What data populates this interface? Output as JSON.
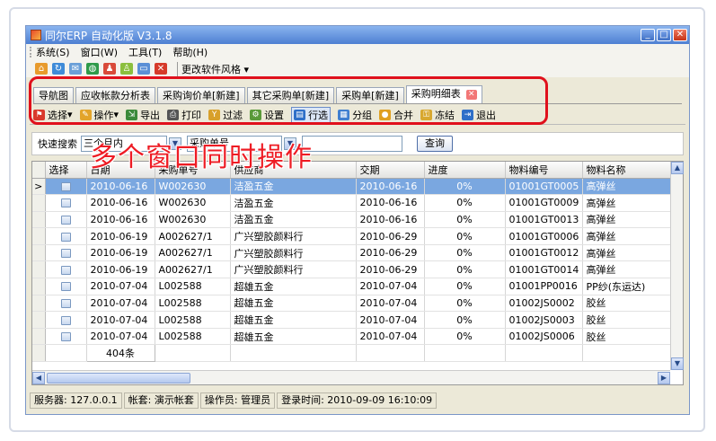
{
  "window": {
    "title": "同尔ERP 自动化版 V3.1.8",
    "controls": [
      "_",
      "□",
      "✕"
    ]
  },
  "menubar": {
    "items": [
      "系统(S)",
      "窗口(W)",
      "工具(T)",
      "帮助(H)"
    ]
  },
  "iconbar": {
    "style_menu_label": "更改软件风格"
  },
  "tabs": [
    {
      "label": "导航图",
      "active": false
    },
    {
      "label": "应收帐款分析表",
      "active": false
    },
    {
      "label": "采购询价单[新建]",
      "active": false
    },
    {
      "label": "其它采购单[新建]",
      "active": false
    },
    {
      "label": "采购单[新建]",
      "active": false
    },
    {
      "label": "采购明细表",
      "active": true
    }
  ],
  "toolbar": {
    "select": "选择",
    "operate": "操作",
    "export": "导出",
    "print": "打印",
    "filter": "过滤",
    "settings": "设置",
    "row_select": "行选",
    "group": "分组",
    "merge": "合并",
    "freeze": "冻结",
    "exit": "退出"
  },
  "search": {
    "label": "快速搜索",
    "range_value": "三个月内",
    "field_value": "采购单号",
    "query_button": "查询"
  },
  "overlay_caption": "多个窗口同时操作",
  "grid": {
    "columns": [
      "选择",
      "日期",
      "采购单号",
      "供应商",
      "交期",
      "进度",
      "物料编号",
      "物料名称"
    ],
    "rows": [
      {
        "date": "2010-06-16",
        "order_no": "W002630",
        "supplier": "洁盈五金",
        "delivery": "2010-06-16",
        "progress": "0%",
        "material_code": "01001GT0005",
        "material_name": "高弹丝"
      },
      {
        "date": "2010-06-16",
        "order_no": "W002630",
        "supplier": "洁盈五金",
        "delivery": "2010-06-16",
        "progress": "0%",
        "material_code": "01001GT0009",
        "material_name": "高弹丝"
      },
      {
        "date": "2010-06-16",
        "order_no": "W002630",
        "supplier": "洁盈五金",
        "delivery": "2010-06-16",
        "progress": "0%",
        "material_code": "01001GT0013",
        "material_name": "高弹丝"
      },
      {
        "date": "2010-06-19",
        "order_no": "A002627/1",
        "supplier": "广兴塑胶颜料行",
        "delivery": "2010-06-29",
        "progress": "0%",
        "material_code": "01001GT0006",
        "material_name": "高弹丝"
      },
      {
        "date": "2010-06-19",
        "order_no": "A002627/1",
        "supplier": "广兴塑胶颜料行",
        "delivery": "2010-06-29",
        "progress": "0%",
        "material_code": "01001GT0012",
        "material_name": "高弹丝"
      },
      {
        "date": "2010-06-19",
        "order_no": "A002627/1",
        "supplier": "广兴塑胶颜料行",
        "delivery": "2010-06-29",
        "progress": "0%",
        "material_code": "01001GT0014",
        "material_name": "高弹丝"
      },
      {
        "date": "2010-07-04",
        "order_no": "L002588",
        "supplier": "超雄五金",
        "delivery": "2010-07-04",
        "progress": "0%",
        "material_code": "01001PP0016",
        "material_name": "PP纱(东运达)"
      },
      {
        "date": "2010-07-04",
        "order_no": "L002588",
        "supplier": "超雄五金",
        "delivery": "2010-07-04",
        "progress": "0%",
        "material_code": "01002JS0002",
        "material_name": "胶丝"
      },
      {
        "date": "2010-07-04",
        "order_no": "L002588",
        "supplier": "超雄五金",
        "delivery": "2010-07-04",
        "progress": "0%",
        "material_code": "01002JS0003",
        "material_name": "胶丝"
      },
      {
        "date": "2010-07-04",
        "order_no": "L002588",
        "supplier": "超雄五金",
        "delivery": "2010-07-04",
        "progress": "0%",
        "material_code": "01002JS0006",
        "material_name": "胶丝"
      }
    ],
    "selected_row": 0,
    "footer_count": "404条"
  },
  "statusbar": {
    "server": "服务器: 127.0.0.1",
    "account": "帐套: 演示帐套",
    "operator": "操作员: 管理员",
    "login_time": "登录时间: 2010-09-09 16:10:09"
  },
  "colors": {
    "highlight": "#e0101c",
    "selected_row": "#7aa7e0",
    "titlebar": "#4d7fd2"
  }
}
